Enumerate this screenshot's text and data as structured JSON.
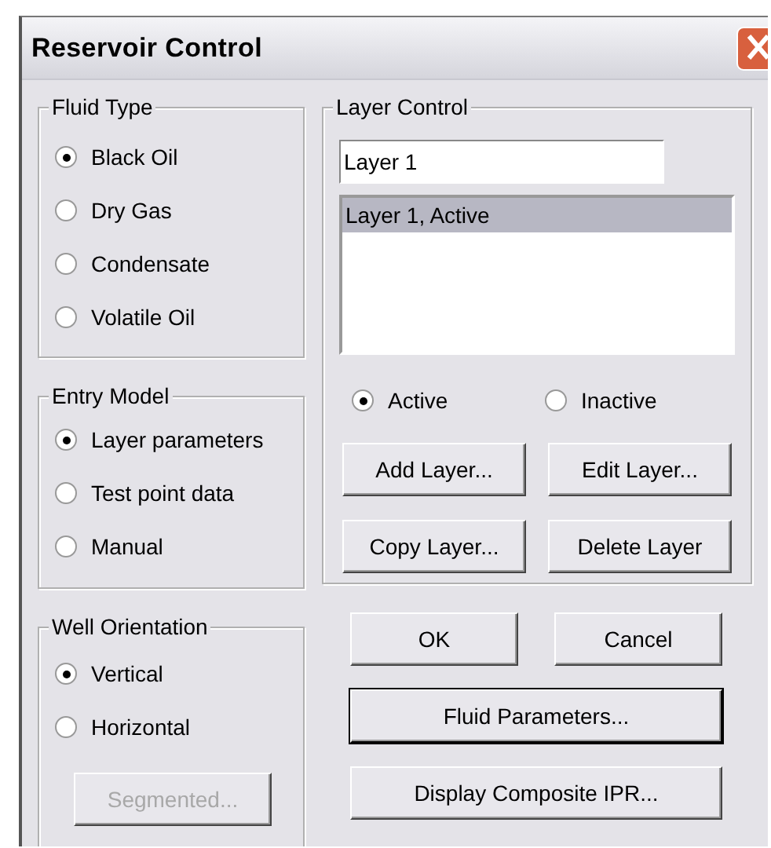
{
  "window": {
    "title": "Reservoir Control"
  },
  "fluid_type": {
    "label": "Fluid Type",
    "options": [
      {
        "label": "Black Oil",
        "selected": true
      },
      {
        "label": "Dry Gas",
        "selected": false
      },
      {
        "label": "Condensate",
        "selected": false
      },
      {
        "label": "Volatile Oil",
        "selected": false
      }
    ]
  },
  "entry_model": {
    "label": "Entry Model",
    "options": [
      {
        "label": "Layer parameters",
        "selected": true
      },
      {
        "label": "Test point data",
        "selected": false
      },
      {
        "label": "Manual",
        "selected": false
      }
    ]
  },
  "well_orientation": {
    "label": "Well Orientation",
    "options": [
      {
        "label": "Vertical",
        "selected": true
      },
      {
        "label": "Horizontal",
        "selected": false
      }
    ],
    "button": {
      "label": "Segmented...",
      "disabled": true
    }
  },
  "layer_control": {
    "label": "Layer Control",
    "name_value": "Layer 1",
    "layers": [
      {
        "label": "Layer 1, Active",
        "selected": true
      }
    ],
    "status_options": [
      {
        "label": "Active",
        "selected": true
      },
      {
        "label": "Inactive",
        "selected": false
      }
    ],
    "buttons": [
      {
        "label": "Add Layer..."
      },
      {
        "label": "Edit Layer..."
      },
      {
        "label": "Copy Layer..."
      },
      {
        "label": "Delete Layer"
      }
    ]
  },
  "buttons": [
    {
      "label": "OK",
      "default": false
    },
    {
      "label": "Cancel",
      "default": false
    }
  ],
  "wide_buttons": [
    {
      "label": "Fluid Parameters...",
      "default": true
    },
    {
      "label": "Display Composite IPR...",
      "default": false
    }
  ]
}
